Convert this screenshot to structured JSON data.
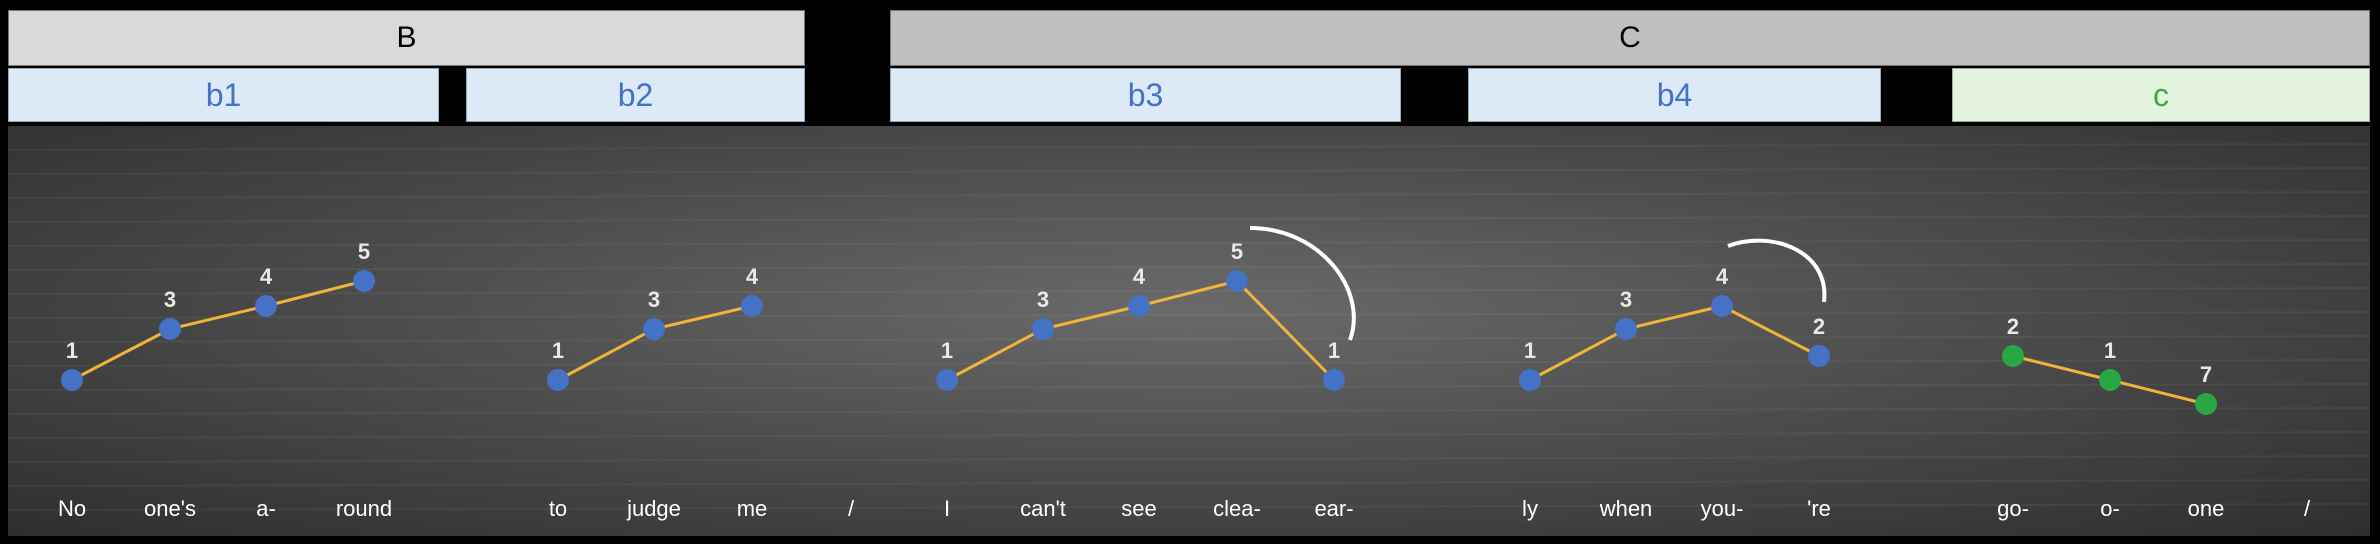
{
  "sections": [
    {
      "label": "B",
      "color": "#d9d9d9"
    },
    {
      "label": "C",
      "color": "#bfbfbf"
    }
  ],
  "phrases": [
    {
      "label": "b1",
      "bg": "#dce9f7",
      "fg": "#4472c4"
    },
    {
      "label": "b2",
      "bg": "#dce9f7",
      "fg": "#4472c4"
    },
    {
      "label": "b3",
      "bg": "#dce9f7",
      "fg": "#4472c4"
    },
    {
      "label": "b4",
      "bg": "#dce9f7",
      "fg": "#4472c4"
    },
    {
      "label": "c",
      "bg": "#e4f3dc",
      "fg": "#3aaa47"
    }
  ],
  "colors": {
    "blue_dot": "#4472c4",
    "green_dot": "#27a844",
    "line": "#f2b33a"
  },
  "groups": [
    {
      "dot": "blue",
      "notes": [
        {
          "deg": "1",
          "syl": "No"
        },
        {
          "deg": "3",
          "syl": "one's"
        },
        {
          "deg": "4",
          "syl": "a-"
        },
        {
          "deg": "5",
          "syl": "round"
        }
      ]
    },
    {
      "dot": "blue",
      "notes": [
        {
          "deg": "1",
          "syl": "to"
        },
        {
          "deg": "3",
          "syl": "judge"
        },
        {
          "deg": "4",
          "syl": "me"
        }
      ]
    },
    {
      "dot": "blue",
      "notes": [
        {
          "deg": "1",
          "syl": "I"
        },
        {
          "deg": "3",
          "syl": "can't"
        },
        {
          "deg": "4",
          "syl": "see"
        },
        {
          "deg": "5",
          "syl": "clea-"
        },
        {
          "deg": "1",
          "syl": "ear-"
        }
      ]
    },
    {
      "dot": "blue",
      "notes": [
        {
          "deg": "1",
          "syl": "ly"
        },
        {
          "deg": "3",
          "syl": "when"
        },
        {
          "deg": "4",
          "syl": "you-"
        },
        {
          "deg": "2",
          "syl": "'re"
        }
      ]
    },
    {
      "dot": "green",
      "notes": [
        {
          "deg": "2",
          "syl": "go-"
        },
        {
          "deg": "1",
          "syl": "o-"
        },
        {
          "deg": "7",
          "syl": "one"
        }
      ]
    }
  ],
  "separators": [
    "/",
    "/"
  ]
}
